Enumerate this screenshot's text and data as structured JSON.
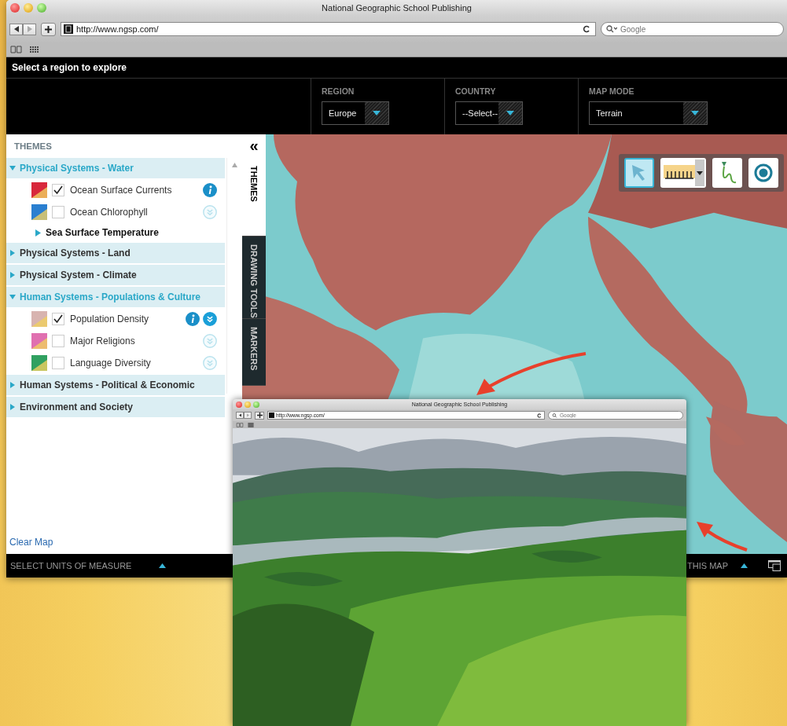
{
  "window": {
    "title": "National Geographic School Publishing",
    "url": "http://www.ngsp.com/",
    "search_placeholder": "Google"
  },
  "header": {
    "title": "Select a region to explore"
  },
  "selectors": [
    {
      "label": "REGION",
      "value": "Europe"
    },
    {
      "label": "COUNTRY",
      "value": "--Select--"
    },
    {
      "label": "MAP MODE",
      "value": "Terrain"
    }
  ],
  "sidebar": {
    "title": "THEMES",
    "collapse_glyph": "«",
    "clear_link": "Clear Map",
    "groups": [
      {
        "label": "Physical Systems - Water",
        "expanded": true,
        "children": [
          {
            "kind": "layer",
            "label": "Ocean Surface Currents",
            "checked": true,
            "info": true,
            "color": "#d8283c"
          },
          {
            "kind": "layer",
            "label": "Ocean Chlorophyll",
            "checked": false,
            "info": false,
            "details_open": false,
            "color": "#2a7fd0"
          },
          {
            "kind": "subgroup",
            "label": "Sea Surface Temperature",
            "expanded": false
          }
        ]
      },
      {
        "label": "Physical Systems - Land",
        "expanded": false
      },
      {
        "label": "Physical System - Climate",
        "expanded": false
      },
      {
        "label": "Human Systems - Populations & Culture",
        "expanded": true,
        "children": [
          {
            "kind": "layer",
            "label": "Population Density",
            "checked": true,
            "info": true,
            "details_open": true,
            "color": "#d8b4b0"
          },
          {
            "kind": "layer",
            "label": "Major Religions",
            "checked": false,
            "info": false,
            "details_open": false,
            "color": "#e070b0"
          },
          {
            "kind": "layer",
            "label": "Language Diversity",
            "checked": false,
            "info": false,
            "details_open": false,
            "color": "#30a060"
          }
        ]
      },
      {
        "label": "Human Systems - Political & Economic",
        "expanded": false
      },
      {
        "label": "Environment and Society",
        "expanded": false
      }
    ]
  },
  "side_tabs": [
    {
      "label": "THEMES",
      "selected": true
    },
    {
      "label": "DRAWING TOOLS",
      "selected": false
    },
    {
      "label": "MARKERS",
      "selected": false
    }
  ],
  "map_tools": [
    {
      "kind": "pointer",
      "selected": true
    },
    {
      "kind": "ruler",
      "selected": false
    },
    {
      "kind": "draw",
      "selected": false
    },
    {
      "kind": "marker",
      "selected": false
    }
  ],
  "status_bar": {
    "left": "SELECT UNITS OF MEASURE",
    "right": "THIS MAP"
  },
  "popup_window": {
    "title": "National Geographic School Publishing",
    "url": "http://www.ngsp.com/",
    "search_placeholder": "Google"
  }
}
